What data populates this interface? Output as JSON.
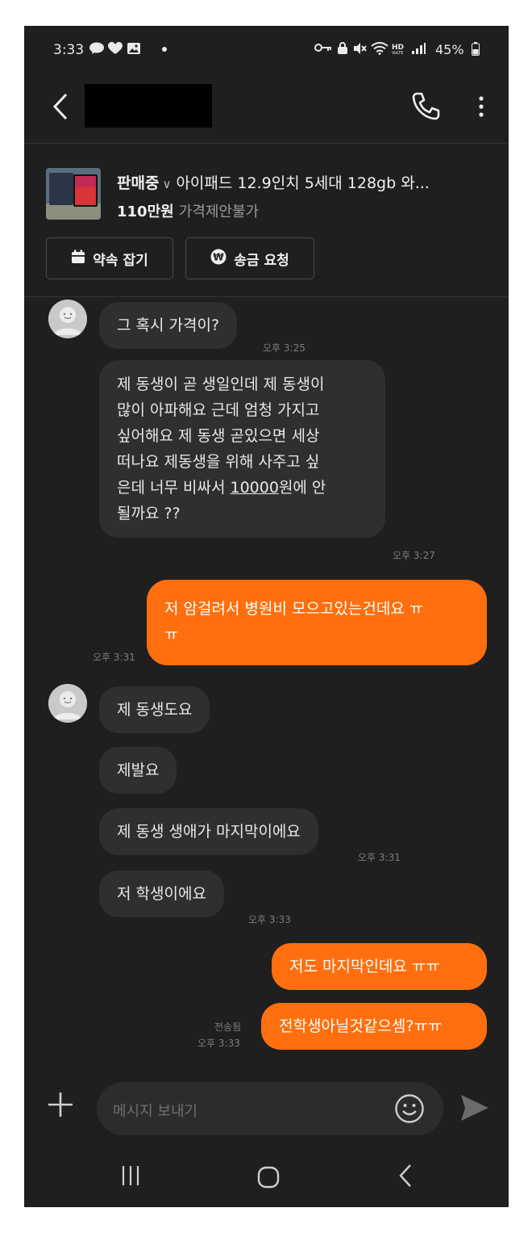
{
  "status_bar": {
    "time": "3:33",
    "battery": "45%",
    "left_icons": [
      "talk-icon",
      "heart-icon",
      "gallery-icon",
      "dot-icon"
    ],
    "right_icons": [
      "key-icon",
      "lock-icon",
      "mute-icon",
      "wifi-icon",
      "hd-voice-icon",
      "signal-icon",
      "battery-icon"
    ]
  },
  "header": {
    "title_redacted": true,
    "icons": [
      "back-icon",
      "call-icon",
      "more-icon"
    ]
  },
  "product": {
    "status": "판매중",
    "title": "아이패드 12.9인치 5세대 128gb 와...",
    "price": "110만원",
    "negotiation": "가격제안불가"
  },
  "actions": {
    "appointment": "약속 잡기",
    "remit": "송금 요청"
  },
  "messages": {
    "m1": "그 혹시 가격이?",
    "m1_time": "오후 3:25",
    "m2_lines": [
      "제 동생이 곧 생일인데 제 동생이",
      "많이 아파해요 근데 엄청 가지고",
      "싶어해요 제 동생 곧있으면 세상",
      "떠나요 제동생을 위해 사주고 싶"
    ],
    "m2_pre": "은데 너무 비싸서 ",
    "m2_link": "10000",
    "m2_post": "원에 안",
    "m2_last": "될까요 ??",
    "m2_time": "오후 3:27",
    "m3_lines": [
      "저 암걸려서 병원비 모으고있는건데요 ㅠ",
      "ㅠ"
    ],
    "m3_time": "오후 3:31",
    "m4": "제 동생도요",
    "m5": "제발요",
    "m6": "제 동생 생애가 마지막이에요",
    "m6_time": "오후 3:31",
    "m7": "저 학생이에요",
    "m7_time": "오후 3:33",
    "m8": "저도 마지막인데요 ㅠㅠ",
    "m9": "전학생아닐것같으셈?ㅠㅠ",
    "m9_sent": "전송됨",
    "m9_time": "오후 3:33"
  },
  "input": {
    "placeholder": "메시지 보내기"
  },
  "colors": {
    "background": "#1f1f20",
    "incoming_bubble": "#2f2f31",
    "outgoing_bubble": "#ff6f0f",
    "text": "#e9e9ea",
    "muted": "#7d7d7f"
  }
}
